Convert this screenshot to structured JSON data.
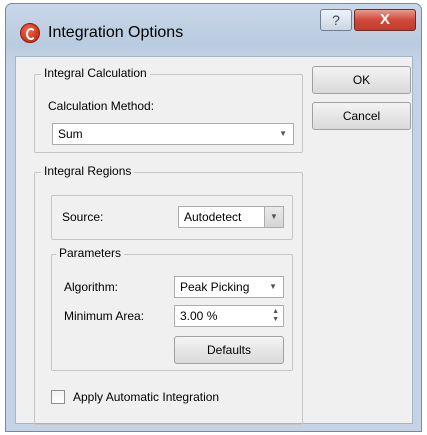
{
  "window": {
    "title": "Integration Options",
    "help_label": "?",
    "close_label": "X"
  },
  "integral_calculation": {
    "group_label": "Integral Calculation",
    "method_label": "Calculation Method:",
    "method_value": "Sum"
  },
  "integral_regions": {
    "group_label": "Integral Regions",
    "source_label": "Source:",
    "source_value": "Autodetect",
    "parameters": {
      "group_label": "Parameters",
      "algorithm_label": "Algorithm:",
      "algorithm_value": "Peak Picking",
      "min_area_label": "Minimum Area:",
      "min_area_value": "3.00 %",
      "defaults_label": "Defaults"
    },
    "auto_integration_label": "Apply Automatic Integration",
    "auto_integration_checked": false
  },
  "buttons": {
    "ok_label": "OK",
    "cancel_label": "Cancel"
  },
  "icons": {
    "app": "app-logo-icon",
    "dropdown": "chevron-down-icon"
  }
}
